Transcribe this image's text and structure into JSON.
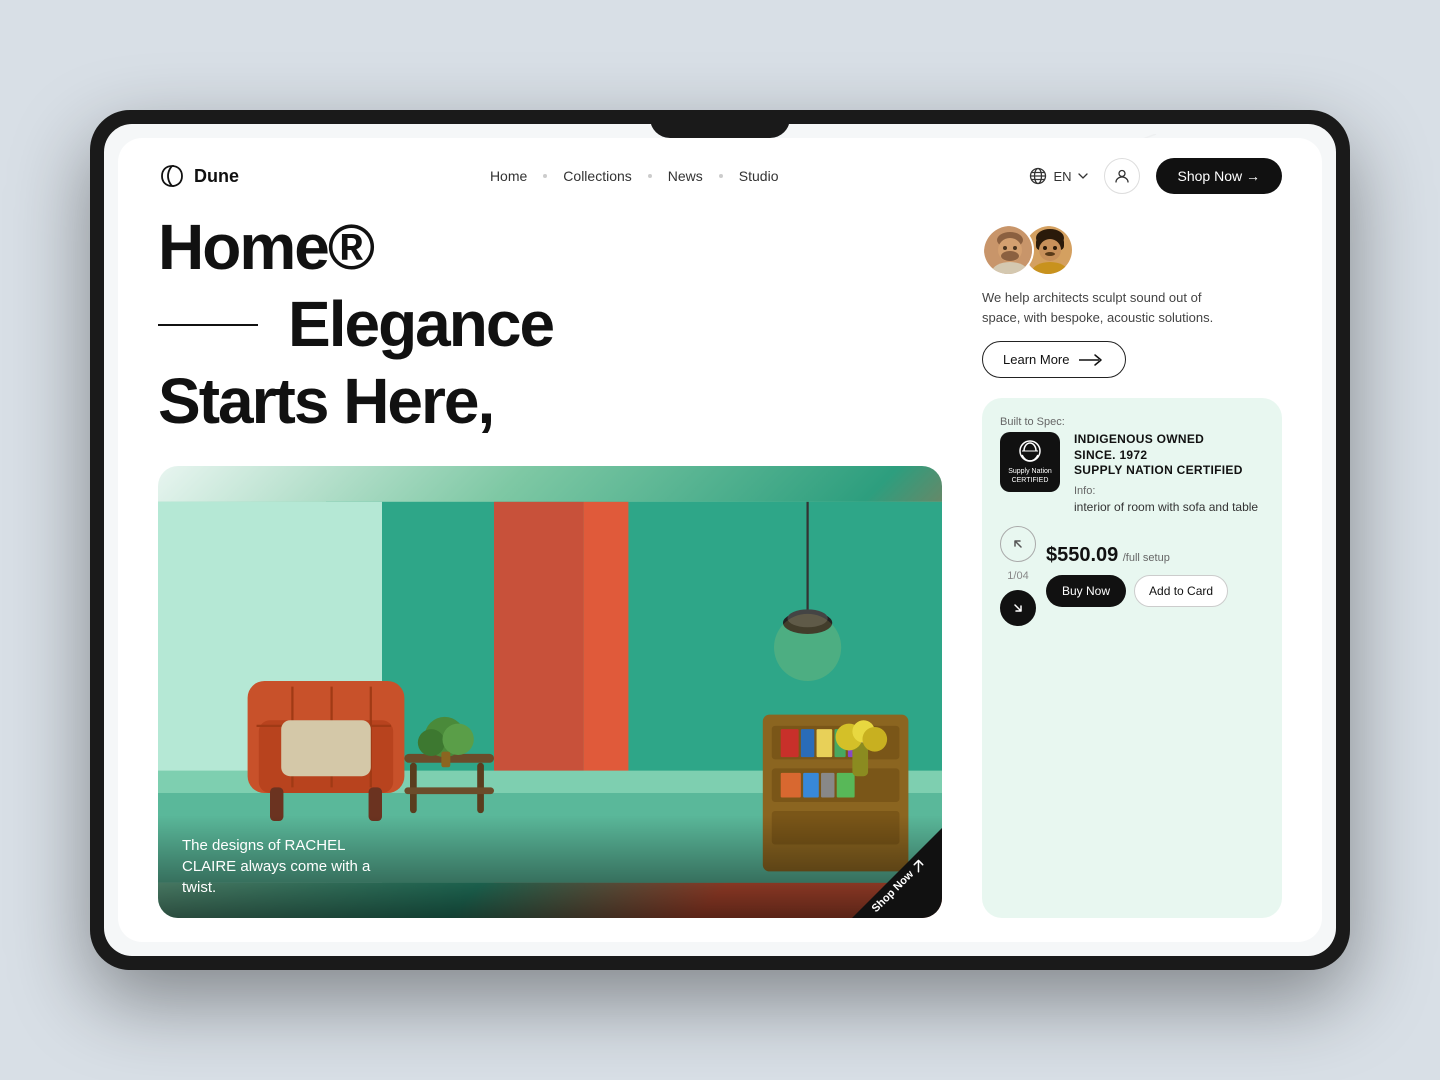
{
  "device": {
    "notch": true
  },
  "navbar": {
    "logo_text": "Dune",
    "nav_items": [
      {
        "label": "Home",
        "id": "home"
      },
      {
        "label": "Collections",
        "id": "collections"
      },
      {
        "label": "News",
        "id": "news"
      },
      {
        "label": "Studio",
        "id": "studio"
      }
    ],
    "lang": "EN",
    "shop_now_label": "Shop Now →"
  },
  "hero": {
    "title_line1": "Home®",
    "title_line2": "Elegance",
    "title_line3": "Starts Here,",
    "overlay_text": "The designs of RACHEL CLAIRE always come with a twist.",
    "shop_corner_label": "Shop Now"
  },
  "architects": {
    "description": "We help architects sculpt sound out of space, with bespoke, acoustic solutions.",
    "learn_more_label": "Learn More",
    "arrow": "→"
  },
  "product": {
    "built_to_spec_label": "Built to Spec:",
    "spec_title_line1": "INDIGENOUS OWNED",
    "spec_title_line2": "SINCE. 1972",
    "spec_title_line3": "SUPPLY NATION CERTIFIED",
    "info_label": "Info:",
    "info_text": "interior of room with sofa and table",
    "supply_badge_line1": "Supply Nation",
    "supply_badge_line2": "CERTIFIED",
    "page_indicator": "1/04",
    "price": "$550.09",
    "price_suffix": "/full setup",
    "buy_now_label": "Buy Now",
    "add_to_card_label": "Add to Card"
  }
}
